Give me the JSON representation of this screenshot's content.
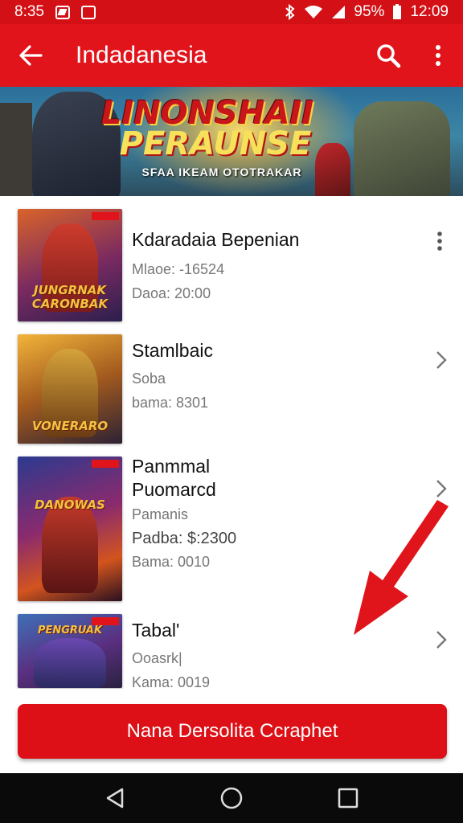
{
  "status_bar": {
    "time": "8:35",
    "battery": "95%",
    "clock": "12:09"
  },
  "app_bar": {
    "title": "Indadanesia"
  },
  "banner": {
    "title_line1": "LINONSHAII",
    "title_line2": "PERAUNSE",
    "tagline": "SFAA IKEAM OTOTRAKAR"
  },
  "list": {
    "items": [
      {
        "title": "Kdaradaia Bepenian",
        "line1": "Mlaoe: -16524",
        "line2": "Daoa: 20:00",
        "cover_caption": "JUNGRNAK CARONBAK",
        "action": "more"
      },
      {
        "title": "Stamlbaic",
        "line1": "Soba",
        "line2": "bama: 8301",
        "cover_caption": "VONERARO",
        "action": "chevron"
      },
      {
        "title": "Panmmal Puomarcd",
        "line1": "Pamanis",
        "line2": "Padba: $:2300",
        "line3": "Bama: 0010",
        "cover_caption": "DANOWAS",
        "action": "chevron"
      },
      {
        "title": "Tabal'",
        "line1": "Ooasrk|",
        "line2": "Kama: 0019",
        "cover_caption": "PENGRUAK",
        "action": "chevron"
      }
    ]
  },
  "cta": {
    "label": "Nana Dersolita Ccraphet"
  },
  "colors": {
    "primary": "#e1141b",
    "status": "#d31015",
    "nav": "#0a0a0a"
  }
}
